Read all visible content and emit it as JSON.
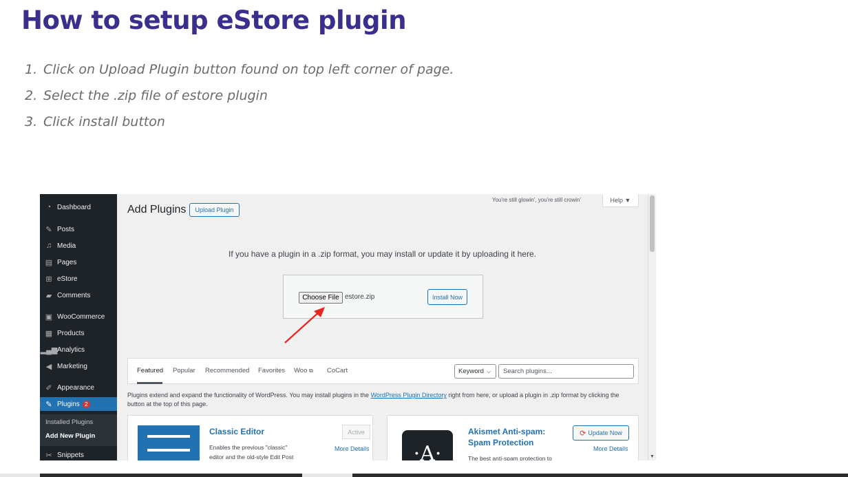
{
  "article": {
    "title": "How to setup eStore plugin",
    "steps": [
      {
        "num": "1.",
        "text": "Click on Upload Plugin button found on top left corner of page."
      },
      {
        "num": "2.",
        "text": "Select the .zip file of estore plugin"
      },
      {
        "num": "3.",
        "text": "Click install button"
      }
    ]
  },
  "sidebar": {
    "items": [
      {
        "label": "Dashboard",
        "icon": "dashboard-icon"
      },
      {
        "label": "Posts",
        "icon": "pin-icon"
      },
      {
        "label": "Media",
        "icon": "media-icon"
      },
      {
        "label": "Pages",
        "icon": "pages-icon"
      },
      {
        "label": "eStore",
        "icon": "cart-icon"
      },
      {
        "label": "Comments",
        "icon": "comment-icon"
      },
      {
        "label": "WooCommerce",
        "icon": "woo-icon"
      },
      {
        "label": "Products",
        "icon": "products-icon"
      },
      {
        "label": "Analytics",
        "icon": "chart-icon"
      },
      {
        "label": "Marketing",
        "icon": "megaphone-icon"
      },
      {
        "label": "Appearance",
        "icon": "brush-icon"
      },
      {
        "label": "Plugins",
        "icon": "plug-icon",
        "badge": "2"
      },
      {
        "label": "Snippets",
        "icon": "scissors-icon"
      }
    ],
    "submenu": [
      "Installed Plugins",
      "Add New Plugin"
    ]
  },
  "header": {
    "title": "Add Plugins",
    "upload_button": "Upload Plugin",
    "screen_meta": "You're still glowin', you're still crowin'",
    "help": "Help ▼"
  },
  "upload": {
    "description": "If you have a plugin in a .zip format, you may install or update it by uploading it here.",
    "choose_file": "Choose File",
    "file_name": "estore.zip",
    "install_now": "Install Now"
  },
  "filter": {
    "tabs": [
      "Featured",
      "Popular",
      "Recommended",
      "Favorites",
      "Woo",
      "CoCart"
    ],
    "keyword": "Keyword",
    "search_placeholder": "Search plugins..."
  },
  "intro": {
    "before_link": "Plugins extend and expand the functionality of WordPress. You may install plugins in the ",
    "link": "WordPress Plugin Directory",
    "after_link": " right from here, or upload a plugin in .zip format by clicking the button at the top of this page."
  },
  "cards": [
    {
      "title": "Classic Editor",
      "status": "Active",
      "more": "More Details",
      "desc_line1": "Enables the previous \"classic\"",
      "desc_line2": "editor and the old-style Edit Post"
    },
    {
      "title_line1": "Akismet Anti-spam:",
      "title_line2": "Spam Protection",
      "icon_text": "·A·",
      "update": "Update Now",
      "more": "More Details",
      "desc_line1": "The best anti-spam protection to"
    }
  ],
  "colors": {
    "title": "#3b2f8e",
    "wp_blue": "#2271b1",
    "sidebar_bg": "#1d2327",
    "arrow_red": "#e8261f"
  }
}
